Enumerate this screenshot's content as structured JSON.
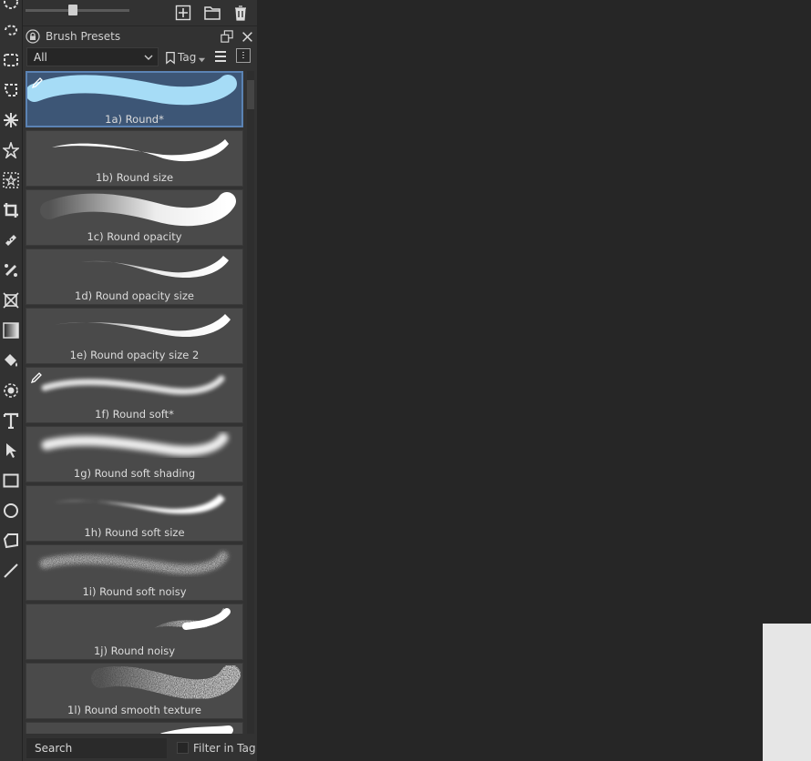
{
  "panel": {
    "title": "Brush Presets",
    "filter_value": "All",
    "tag_label": "Tag",
    "search_placeholder": "Search",
    "filter_in_tag_label": "Filter in Tag"
  },
  "presets": [
    {
      "label": "1a) Round*"
    },
    {
      "label": "1b) Round size"
    },
    {
      "label": "1c) Round opacity"
    },
    {
      "label": "1d) Round opacity size"
    },
    {
      "label": "1e) Round opacity size 2"
    },
    {
      "label": "1f) Round soft*"
    },
    {
      "label": "1g) Round soft shading"
    },
    {
      "label": "1h) Round soft size"
    },
    {
      "label": "1i) Round soft noisy"
    },
    {
      "label": "1j) Round noisy"
    },
    {
      "label": "1l) Round smooth texture"
    }
  ],
  "colors": {
    "selected_preset_bg": "#3d5676",
    "selected_stroke": "#a6dcf6",
    "preset_bg": "#4a4a4a",
    "stroke_white": "#ffffff",
    "canvas_bg": "#262626"
  },
  "icons": {
    "toolbox": [
      "ellipse-select-icon",
      "freehand-select-icon",
      "rectangle-select-icon",
      "polygon-select-icon",
      "magic-wand-icon",
      "similar-color-select-icon",
      "select-shapes-icon",
      "crop-icon",
      "smart-patch-icon",
      "clone-tool-icon",
      "transform-icon",
      "gradient-icon",
      "fill-bucket-icon",
      "color-picker-icon",
      "text-tool-icon",
      "move-pointer-icon",
      "rectangle-tool-icon",
      "ellipse-tool-icon",
      "polygon-tool-icon",
      "line-tool-icon"
    ]
  }
}
